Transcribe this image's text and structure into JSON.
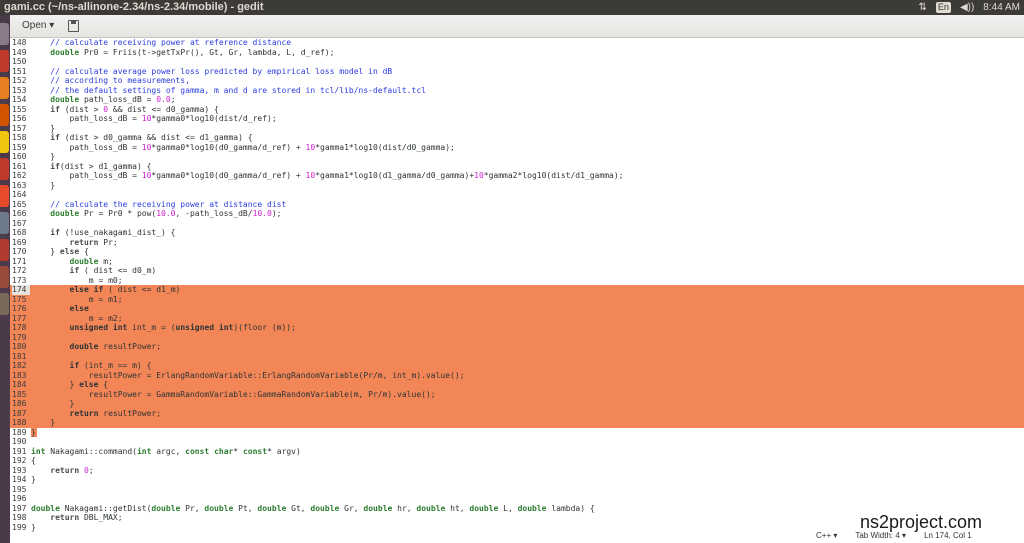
{
  "window": {
    "title": "gami.cc (~/ns-allinone-2.34/ns-2.34/mobile) - gedit",
    "tray": {
      "updown": "⇅",
      "lang": "En",
      "volume": "◀))",
      "time": "8:44 AM"
    }
  },
  "toolbar": {
    "open_label": "Open ▾"
  },
  "lines": [
    {
      "n": "148",
      "t": "    // calculate receiving power at reference distance"
    },
    {
      "n": "149",
      "t": "    double Pr0 = Friis(t->getTxPr(), Gt, Gr, lambda, L, d_ref);"
    },
    {
      "n": "150",
      "t": ""
    },
    {
      "n": "151",
      "t": "    // calculate average power loss predicted by empirical loss model in dB"
    },
    {
      "n": "152",
      "t": "    // according to measurements,"
    },
    {
      "n": "153",
      "t": "    // the default settings of gamma, m and d are stored in tcl/lib/ns-default.tcl"
    },
    {
      "n": "154",
      "t": "    double path_loss_dB = 0.0;"
    },
    {
      "n": "155",
      "t": "    if (dist > 0 && dist <= d0_gamma) {"
    },
    {
      "n": "156",
      "t": "        path_loss_dB = 10*gamma0*log10(dist/d_ref);"
    },
    {
      "n": "157",
      "t": "    }"
    },
    {
      "n": "158",
      "t": "    if (dist > d0_gamma && dist <= d1_gamma) {"
    },
    {
      "n": "159",
      "t": "        path_loss_dB = 10*gamma0*log10(d0_gamma/d_ref) + 10*gamma1*log10(dist/d0_gamma);"
    },
    {
      "n": "160",
      "t": "    }"
    },
    {
      "n": "161",
      "t": "    if(dist > d1_gamma) {"
    },
    {
      "n": "162",
      "t": "        path_loss_dB = 10*gamma0*log10(d0_gamma/d_ref) + 10*gamma1*log10(d1_gamma/d0_gamma)+10*gamma2*log10(dist/d1_gamma);"
    },
    {
      "n": "163",
      "t": "    }"
    },
    {
      "n": "164",
      "t": ""
    },
    {
      "n": "165",
      "t": "    // calculate the receiving power at distance dist"
    },
    {
      "n": "166",
      "t": "    double Pr = Pr0 * pow(10.0, -path_loss_dB/10.0);"
    },
    {
      "n": "167",
      "t": ""
    },
    {
      "n": "168",
      "t": "    if (!use_nakagami_dist_) {"
    },
    {
      "n": "169",
      "t": "        return Pr;"
    },
    {
      "n": "170",
      "t": "    } else {"
    },
    {
      "n": "171",
      "t": "        double m;"
    },
    {
      "n": "172",
      "t": "        if ( dist <= d0_m)"
    },
    {
      "n": "173",
      "t": "            m = m0;"
    },
    {
      "n": "174",
      "t": "        else if ( dist <= d1_m)"
    },
    {
      "n": "175",
      "t": "            m = m1;"
    },
    {
      "n": "176",
      "t": "        else"
    },
    {
      "n": "177",
      "t": "            m = m2;"
    },
    {
      "n": "178",
      "t": "        unsigned int int_m = (unsigned int)(floor (m));"
    },
    {
      "n": "179",
      "t": ""
    },
    {
      "n": "180",
      "t": "        double resultPower;"
    },
    {
      "n": "181",
      "t": ""
    },
    {
      "n": "182",
      "t": "        if (int_m == m) {"
    },
    {
      "n": "183",
      "t": "            resultPower = ErlangRandomVariable::ErlangRandomVariable(Pr/m, int_m).value();"
    },
    {
      "n": "184",
      "t": "        } else {"
    },
    {
      "n": "185",
      "t": "            resultPower = GammaRandomVariable::GammaRandomVariable(m, Pr/m).value();"
    },
    {
      "n": "186",
      "t": "        }"
    },
    {
      "n": "187",
      "t": "        return resultPower;"
    },
    {
      "n": "188",
      "t": "    }"
    },
    {
      "n": "189",
      "t": "}"
    },
    {
      "n": "190",
      "t": ""
    },
    {
      "n": "191",
      "t": "int Nakagami::command(int argc, const char* const* argv)"
    },
    {
      "n": "192",
      "t": "{"
    },
    {
      "n": "193",
      "t": "    return 0;"
    },
    {
      "n": "194",
      "t": "}"
    },
    {
      "n": "195",
      "t": ""
    },
    {
      "n": "196",
      "t": ""
    },
    {
      "n": "197",
      "t": "double Nakagami::getDist(double Pr, double Pt, double Gt, double Gr, double hr, double ht, double L, double lambda) {"
    },
    {
      "n": "198",
      "t": "    return DBL_MAX;"
    },
    {
      "n": "199",
      "t": "}"
    }
  ],
  "status": {
    "language": "C++ ▾",
    "tab_width": "Tab Width: 4 ▾",
    "position": "Ln 174, Col 1"
  },
  "watermark": "ns2project.com",
  "colors": {
    "selection": "#f38656",
    "comment": "#2c3ce0",
    "number": "#d020d0",
    "panel": "#3c3b37"
  }
}
